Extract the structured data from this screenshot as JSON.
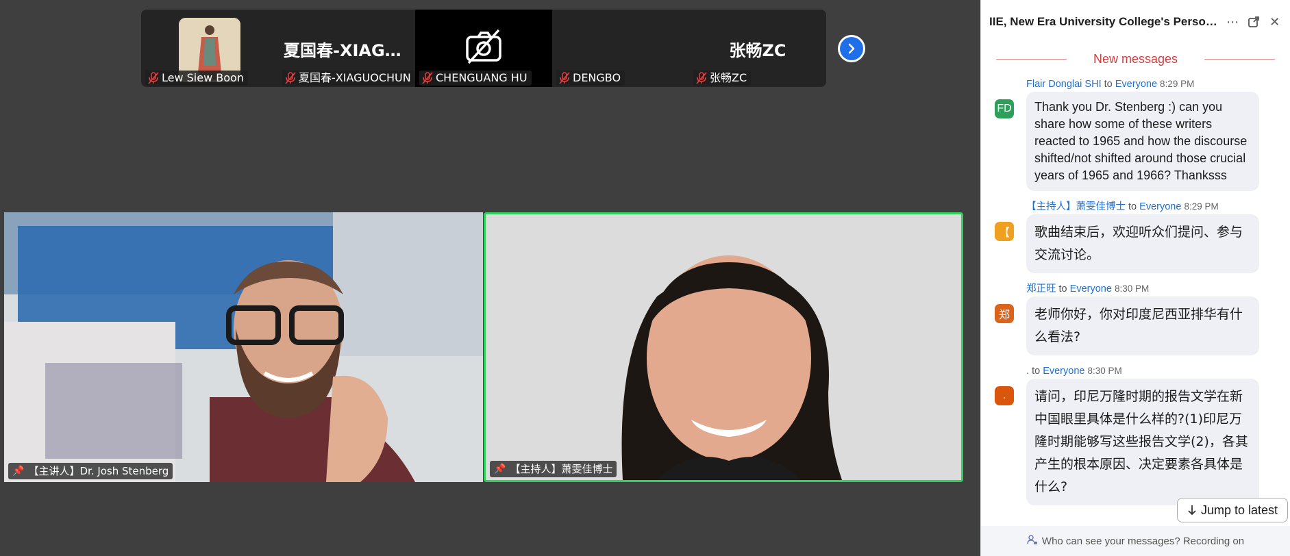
{
  "participants": [
    {
      "display": "",
      "name": "Lew Siew Boon",
      "type": "avatar"
    },
    {
      "display": "夏国春-XIAGUO...",
      "name": "夏国春-XIAGUOCHUN",
      "type": "name"
    },
    {
      "display": "",
      "name": "CHENGUANG HU",
      "type": "camera-off"
    },
    {
      "display": "",
      "name": "DENGBO",
      "type": "name"
    },
    {
      "display": "张畅ZC",
      "name": "张畅ZC",
      "type": "name"
    }
  ],
  "videos": {
    "speaker": {
      "label": "【主讲人】Dr. Josh Stenberg"
    },
    "host": {
      "label": "【主持人】萧雯佳博士"
    }
  },
  "chat": {
    "title": "IIE, New Era University College's Personal M...",
    "new_messages": "New messages",
    "messages": [
      {
        "sender": "Flair Donglai SHI",
        "to": "to",
        "recipient": "Everyone",
        "time": "8:29 PM",
        "avatar": "FD",
        "avatar_color": "#2e9e5b",
        "text": "Thank you Dr. Stenberg :) can you share how some of these writers reacted to 1965 and how the discourse shifted/not shifted around those crucial years of 1965 and 1966? Thanksss",
        "lang": "en"
      },
      {
        "sender": "【主持人】萧雯佳博士",
        "to": "to",
        "recipient": "Everyone",
        "time": "8:29 PM",
        "avatar": "【",
        "avatar_color": "#f0a020",
        "text": "歌曲结束后，欢迎听众们提问、参与交流讨论。",
        "lang": "zh"
      },
      {
        "sender": "郑正旺",
        "to": "to",
        "recipient": "Everyone",
        "time": "8:30 PM",
        "avatar": "郑",
        "avatar_color": "#d9641c",
        "text": "老师你好，你对印度尼西亚排华有什么看法?",
        "lang": "zh"
      },
      {
        "sender": ".",
        "to": "to",
        "recipient": "Everyone",
        "time": "8:30 PM",
        "avatar": ".",
        "avatar_color": "#d9560c",
        "text": "请问，印尼万隆时期的报告文学在新中国眼里具体是什么样的?(1)印尼万隆时期能够写这些报告文学(2)，各其产生的根本原因、决定要素各具体是什么?",
        "lang": "zh"
      }
    ],
    "jump_label": "Jump to latest",
    "footer": "Who can see your messages? Recording on"
  },
  "colors": {
    "accent": "#1f6fe8",
    "active_speaker_border": "#2fd35c",
    "new_messages": "#d23c3c",
    "link": "#1f6fd1"
  },
  "icons": [
    "mic-off-icon",
    "camera-off-icon",
    "chevron-right-icon",
    "more-icon",
    "pop-out-icon",
    "close-icon",
    "pin-icon",
    "arrow-down-icon",
    "person-lock-icon"
  ]
}
